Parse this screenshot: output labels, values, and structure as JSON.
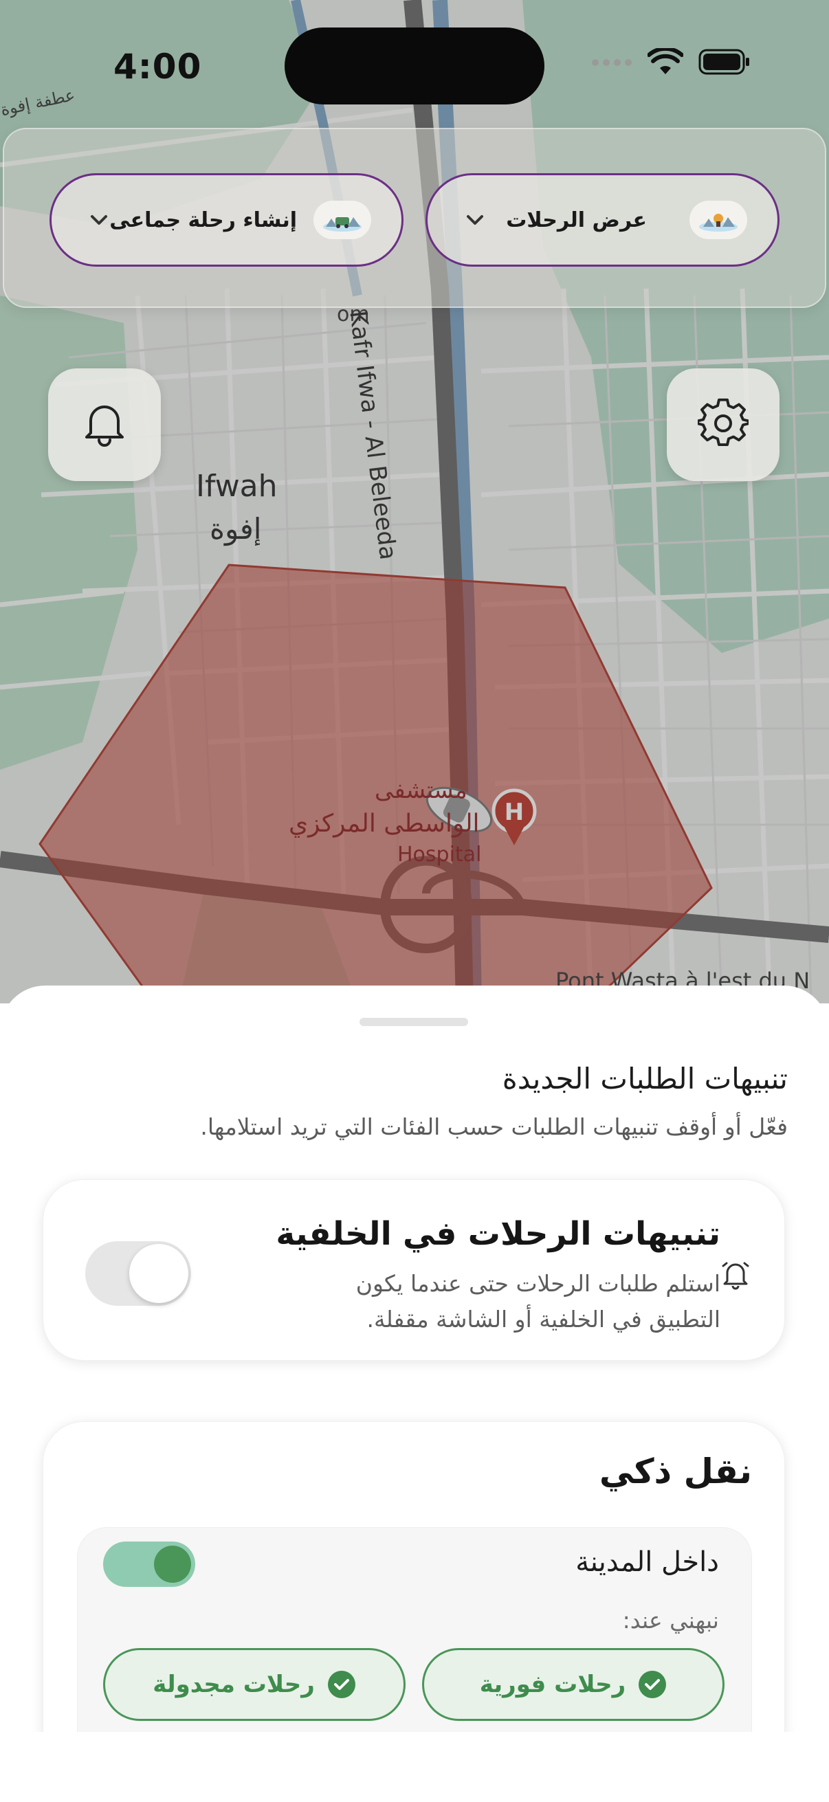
{
  "status_bar": {
    "time": "4:00",
    "wifi_icon": "wifi-icon",
    "battery_icon": "battery-icon"
  },
  "top_bar": {
    "view_trips": {
      "label": "عرض الرحلات",
      "icon": "trips-illustration-icon"
    },
    "create_group_trip": {
      "label": "إنشاء رحلة جماعى",
      "icon": "group-trip-illustration-icon"
    }
  },
  "map": {
    "labels": {
      "ifwah": "Ifwah",
      "ifwah_ar": "إفوة",
      "road": "Kafr Ifwa - Al Beleeda",
      "hospital_ar_1": "مستشفى",
      "hospital_ar_2": "الواسطى المركزي",
      "hospital_en": "Hospital",
      "pont": "Pont Wasta à l'est du N",
      "corner": "عطفة إفوة",
      "om": "om"
    },
    "zone_color": "#c0392b",
    "hospital_marker": "H"
  },
  "buttons": {
    "notifications": "bell-icon",
    "settings": "gear-icon"
  },
  "sheet": {
    "title": "تنبيهات الطلبات الجديدة",
    "subtitle": "فعّل أو أوقف تنبيهات الطلبات حسب الفئات التي تريد استلامها.",
    "background_alerts": {
      "title": "تنبيهات الرحلات في الخلفية",
      "description": "استلم طلبات الرحلات حتى عندما يكون التطبيق في الخلفية أو الشاشة مقفلة.",
      "enabled": false
    },
    "smart_transport": {
      "title": "نقل ذكي",
      "category": {
        "title": "داخل المدينة",
        "enabled": true,
        "notify_label": "نبهني عند:",
        "options": [
          {
            "label": "رحلات فورية",
            "checked": true
          },
          {
            "label": "رحلات مجدولة",
            "checked": true
          }
        ]
      }
    }
  },
  "colors": {
    "accent_green": "#4a9659",
    "pill_border": "#6b2f86"
  }
}
